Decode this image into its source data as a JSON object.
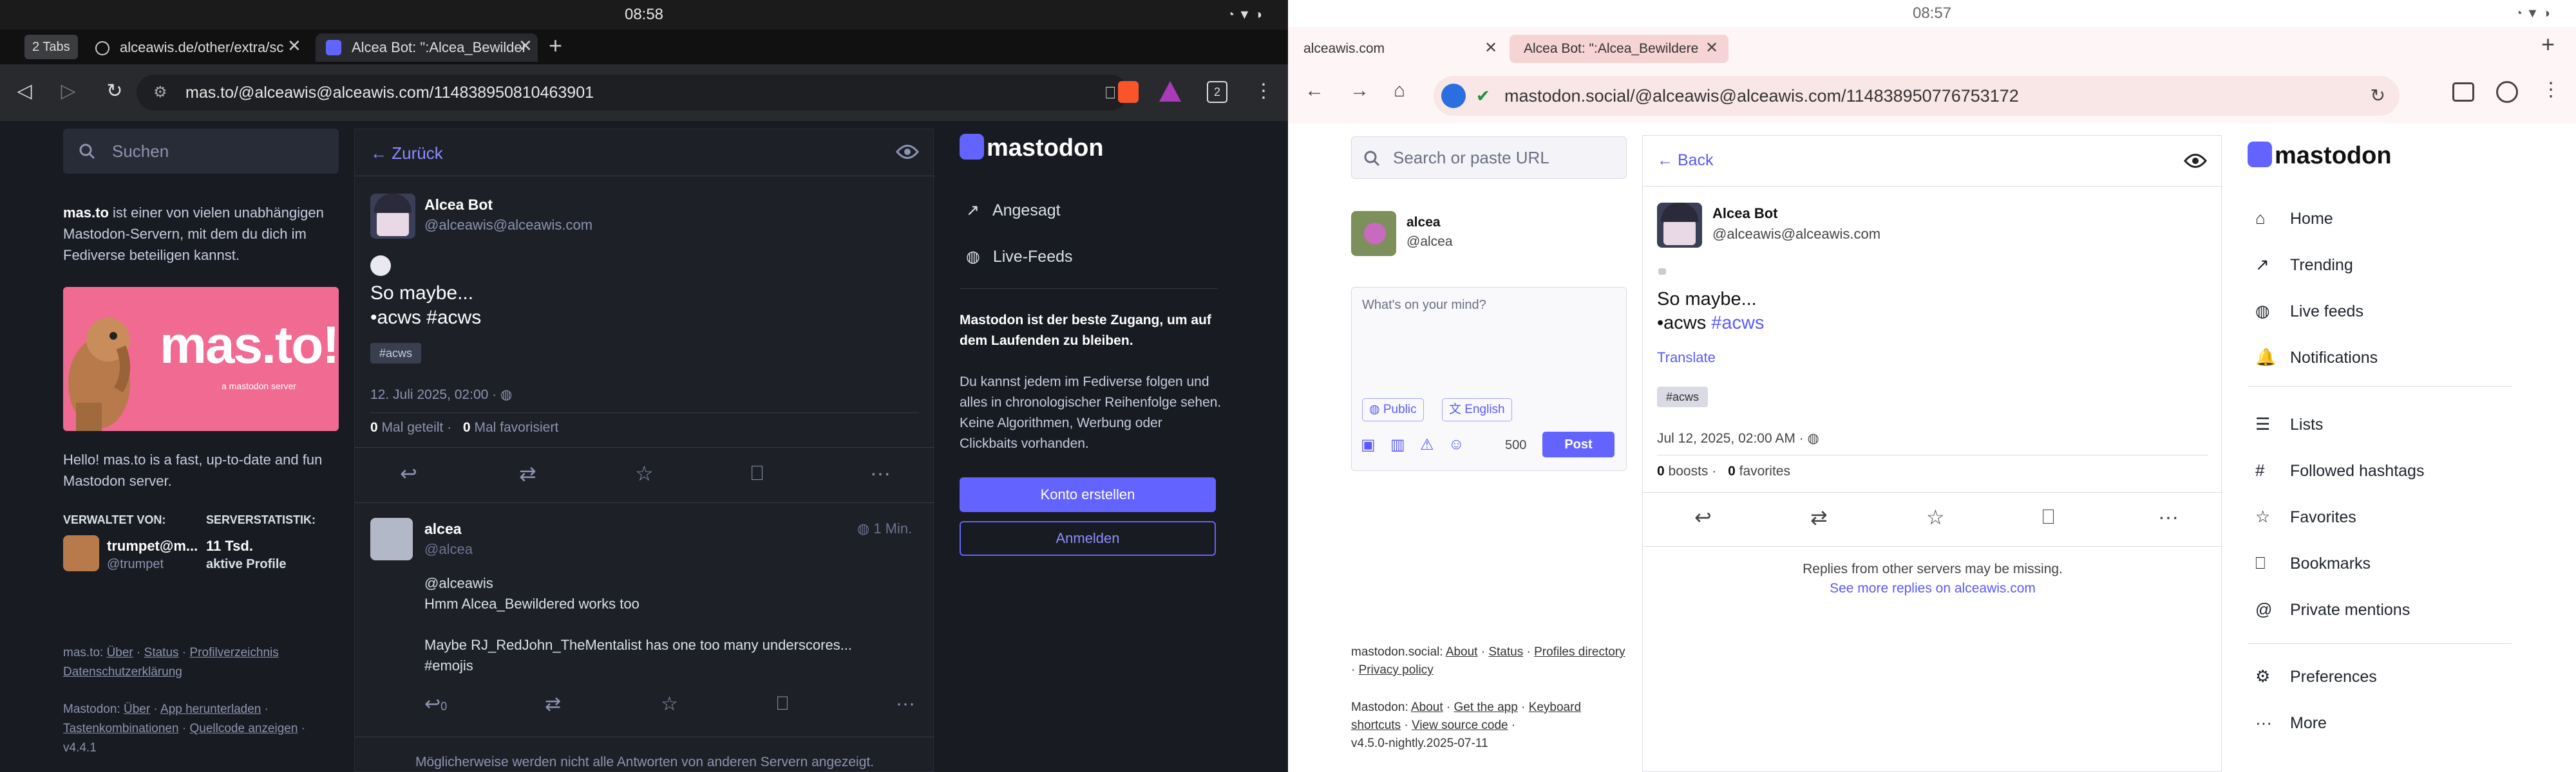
{
  "left": {
    "status_time": "08:58",
    "tab_count": "2 Tabs",
    "tabs": [
      {
        "label": "alceawis.de/other/extra/sc"
      },
      {
        "label": "Alcea Bot: \":Alcea_Bewilder"
      }
    ],
    "url": "mas.to/@alceawis@alceawis.com/114838950810463901",
    "browser_tab_badge": "2",
    "search_placeholder": "Suchen",
    "intro_server": "mas.to",
    "intro_text": " ist einer von vielen unabhängigen Mastodon-Servern, mit dem du dich im Fediverse beteiligen kannst.",
    "banner_title": "mas.to!",
    "banner_sub": "a mastodon server",
    "server_hello": "Hello! mas.to is a fast, up-to-date and fun Mastodon server.",
    "admin_heading": "VERWALTET VON:",
    "admin_name": "trumpet@m...",
    "admin_handle": "@trumpet",
    "stats_heading": "SERVERSTATISTIK:",
    "stats_value": "11 Tsd.",
    "stats_label": "aktive Profile",
    "footer1_prefix": "mas.to: ",
    "footer1_links": [
      "Über",
      "Status",
      "Profilverzeichnis",
      "Datenschutzerklärung"
    ],
    "footer2_prefix": "Mastodon: ",
    "footer2_links": [
      "Über",
      "App herunterladen",
      "Tastenkombinationen",
      "Quellcode anzeigen"
    ],
    "version": "v4.4.1",
    "back_label": "Zurück",
    "post_name": "Alcea Bot",
    "post_handle": "@alceawis@alceawis.com",
    "post_line1": "So maybe...",
    "post_line2": "•acws #acws",
    "post_tag": "#acws",
    "post_date": "12. Juli 2025, 02:00",
    "boosts_count": "0",
    "boosts_label": "Mal geteilt",
    "favs_count": "0",
    "favs_label": "Mal favorisiert",
    "reply_name": "alcea",
    "reply_handle": "@alcea",
    "reply_time": "1 Min.",
    "reply_line1": "@alceawis",
    "reply_line2": "Hmm Alcea_Bewildered works too",
    "reply_line3": "Maybe RJ_RedJohn_TheMentalist has one too many underscores...",
    "reply_line4": "#emojis",
    "reply_count": "0",
    "missing_note": "Möglicherweise werden nicht alle Antworten von anderen Servern angezeigt.",
    "logo_text": "mastodon",
    "nav_items": [
      {
        "label": "Angesagt"
      },
      {
        "label": "Live-Feeds"
      }
    ],
    "promo_bold": "Mastodon ist der beste Zugang, um auf dem Laufenden zu bleiben.",
    "promo_text": "Du kannst jedem im Fediverse folgen und alles in chronologischer Reihenfolge sehen. Keine Algorithmen, Werbung oder Clickbaits vorhanden.",
    "create_account": "Konto erstellen",
    "login": "Anmelden"
  },
  "right": {
    "status_time": "08:57",
    "tabs": [
      {
        "label": "alceawis.com"
      },
      {
        "label": "Alcea Bot: \":Alcea_Bewildere"
      }
    ],
    "url": "mastodon.social/@alceawis@alceawis.com/114838950776753172",
    "search_placeholder": "Search or paste URL",
    "me_name": "alcea",
    "me_handle": "@alcea",
    "compose_placeholder": "What's on your mind?",
    "visibility": "Public",
    "language": "English",
    "char_count": "500",
    "post_button": "Post",
    "footer1_prefix": "mastodon.social: ",
    "footer1_links": [
      "About",
      "Status",
      "Profiles directory",
      "Privacy policy"
    ],
    "footer2_prefix": "Mastodon: ",
    "footer2_links": [
      "About",
      "Get the app",
      "Keyboard shortcuts",
      "View source code"
    ],
    "version": "v4.5.0-nightly.2025-07-11",
    "back_label": "Back",
    "post_name": "Alcea Bot",
    "post_handle": "@alceawis@alceawis.com",
    "post_line1": "So maybe...",
    "post_line2_prefix": "•acws ",
    "post_line2_tag": "#acws",
    "translate": "Translate",
    "post_tag": "#acws",
    "post_date": "Jul 12, 2025, 02:00 AM",
    "boosts_count": "0",
    "boosts_label": "boosts",
    "favs_count": "0",
    "favs_label": "favorites",
    "missing_note": "Replies from other servers may be missing.",
    "see_more_prefix": "See more replies on ",
    "see_more_link": "alceawis.com",
    "logo_text": "mastodon",
    "nav_items": [
      {
        "label": "Home"
      },
      {
        "label": "Trending"
      },
      {
        "label": "Live feeds"
      },
      {
        "label": "Notifications"
      },
      {
        "label": "Lists"
      },
      {
        "label": "Followed hashtags"
      },
      {
        "label": "Favorites"
      },
      {
        "label": "Bookmarks"
      },
      {
        "label": "Private mentions"
      },
      {
        "label": "Preferences"
      },
      {
        "label": "More"
      }
    ]
  },
  "colors": {
    "accent": "#6364ff",
    "dark_bg": "#191b22",
    "banner_pink": "#f06a92"
  }
}
